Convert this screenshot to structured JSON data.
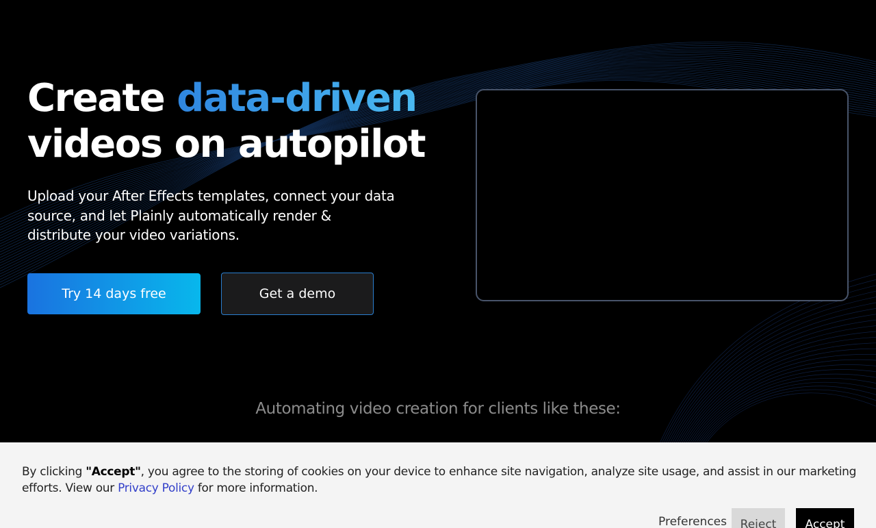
{
  "hero": {
    "title_prefix": "Create ",
    "title_highlight": "data-driven",
    "title_line2": "videos on autopilot",
    "subtitle": "Upload your After Effects templates, connect your data source, and let Plainly automatically render & distribute your video variations.",
    "primary_cta": "Try 14 days free",
    "secondary_cta": "Get a demo",
    "accent_colors": [
      "#2f86e0",
      "#4ab9f1"
    ]
  },
  "clients": {
    "caption": "Automating video creation for clients like these:"
  },
  "cookie_banner": {
    "text_before": "By clicking ",
    "accept_quote": "\"Accept\"",
    "text_after": ", you agree to the storing of cookies on your device to enhance site navigation, analyze site usage, and assist in our marketing efforts. View our ",
    "privacy_link": "Privacy Policy",
    "text_end": " for more information.",
    "preferences_label": "Preferences",
    "reject_label": "Reject",
    "accept_label": "Accept"
  },
  "colors": {
    "background": "#000000",
    "primary_gradient_start": "#1a73e0",
    "primary_gradient_end": "#08b7ec",
    "demo_border": "#2a7fd0",
    "link": "#3340c9"
  }
}
